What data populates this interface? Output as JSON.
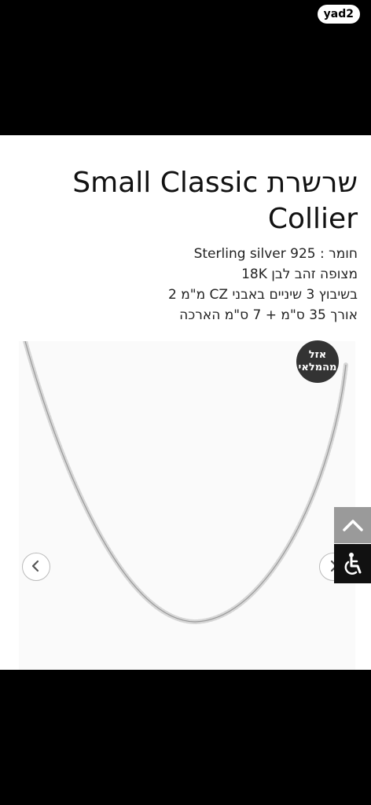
{
  "header": {
    "logo": "yad2"
  },
  "product": {
    "title": "שרשרת Small Classic Collier",
    "specs": [
      "חומר : Sterling silver 925",
      "מצופה זהב לבן 18K",
      "בשיבוץ 3 שיניים באבני CZ מ\"מ 2",
      "אורך 35 ס\"מ + 7 ס\"מ הארכה"
    ]
  },
  "badge": {
    "line1": "אזל",
    "line2": "מהמלאי"
  },
  "gallery": {
    "prev_icon": "chevron-left-icon",
    "next_icon": "chevron-right-icon"
  },
  "floating": {
    "scroll_top_icon": "chevron-up-icon",
    "accessibility_icon": "accessibility-icon"
  },
  "colors": {
    "badge_bg": "#333333",
    "scroll_btn_bg": "#9a9a9a",
    "access_btn_bg": "#111111"
  }
}
